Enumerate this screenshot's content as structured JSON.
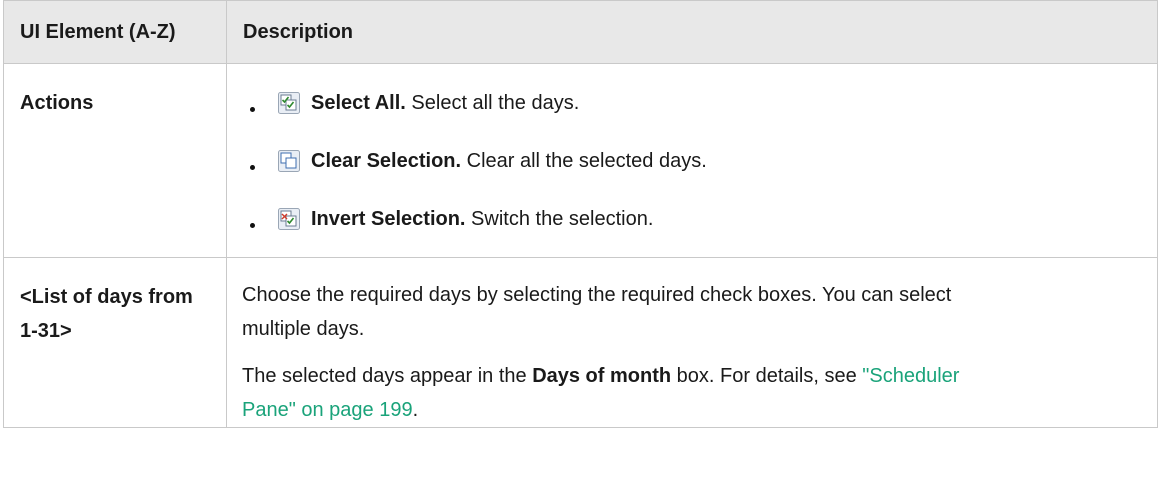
{
  "table": {
    "headers": [
      "UI Element (A-Z)",
      "Description"
    ],
    "rows": {
      "actions": {
        "name": "Actions",
        "items": [
          {
            "icon": "select-all-icon",
            "title": "Select All.",
            "text": " Select all the days."
          },
          {
            "icon": "clear-selection-icon",
            "title": "Clear Selection.",
            "text": " Clear all the selected days."
          },
          {
            "icon": "invert-selection-icon",
            "title": "Invert Selection.",
            "text": " Switch the selection."
          }
        ]
      },
      "days_list": {
        "name": "<List of days from 1-31>",
        "para1": "Choose the required days by selecting the required check boxes. You can select multiple days.",
        "para2_a": "The selected days appear in the ",
        "para2_bold": "Days of month",
        "para2_b": " box. For details, see ",
        "link": "\"Scheduler Pane\" on page 199",
        "para2_c": "."
      }
    }
  },
  "colors": {
    "header_bg": "#e8e8e8",
    "border": "#c9c9c9",
    "link": "#1aa37a"
  }
}
